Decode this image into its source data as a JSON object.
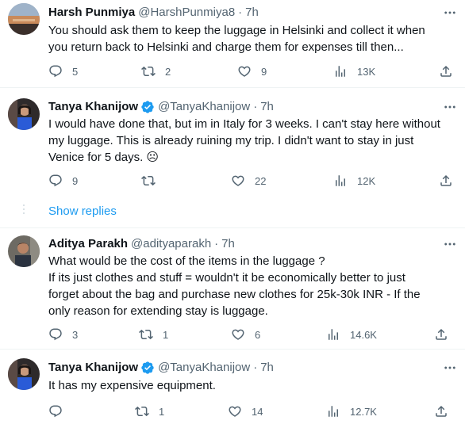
{
  "tweets": [
    {
      "name": "Harsh Punmiya",
      "handle": "@HarshPunmiya8",
      "time": "7h",
      "verified": false,
      "lines": [
        "You should ask them to keep the luggage in Helsinki and collect it when",
        "you return back to Helsinki and charge them for expenses till then..."
      ],
      "replies": "5",
      "retweets": "2",
      "likes": "9",
      "views": "13K"
    },
    {
      "name": "Tanya Khanijow",
      "handle": "@TanyaKhanijow",
      "time": "7h",
      "verified": true,
      "lines": [
        "I would have done that, but im in Italy for 3 weeks. I can't stay here without",
        "my luggage. This is already ruining my trip. I didn't want to stay in just",
        "Venice for 5 days. ☹"
      ],
      "replies": "9",
      "retweets": "",
      "likes": "22",
      "views": "12K"
    },
    {
      "name": "Aditya Parakh",
      "handle": "@adityaparakh",
      "time": "7h",
      "verified": false,
      "lines": [
        "What would be the cost of the items in the luggage ?",
        "If its just clothes and stuff = wouldn't it be economically better to just",
        "forget about the bag and purchase new clothes for 25k-30k INR - If the",
        "only reason for extending stay is luggage."
      ],
      "replies": "3",
      "retweets": "1",
      "likes": "6",
      "views": "14.6K"
    },
    {
      "name": "Tanya Khanijow",
      "handle": "@TanyaKhanijow",
      "time": "7h",
      "verified": true,
      "lines": [
        "It has my expensive equipment."
      ],
      "replies": "",
      "retweets": "1",
      "likes": "14",
      "views": "12.7K"
    }
  ],
  "show_replies": "Show replies",
  "icons": {
    "reply": "reply-icon",
    "retweet": "retweet-icon",
    "like": "heart-icon",
    "views": "views-icon",
    "share": "share-icon",
    "more": "more-icon",
    "verified": "verified-badge-icon"
  },
  "colors": {
    "text": "#0f1419",
    "secondary": "#536471",
    "link": "#1d9bf0",
    "verified": "#1d9bf0",
    "divider": "#eff3f4"
  }
}
